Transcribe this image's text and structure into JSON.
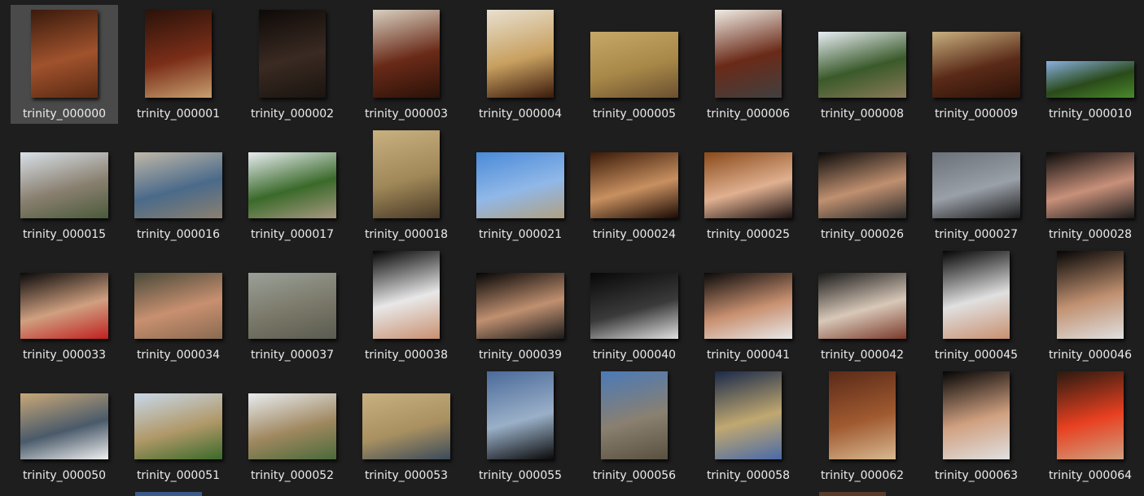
{
  "file_grid": {
    "selected_index": 0,
    "items": [
      {
        "name": "trinity_000000",
        "orientation": "portrait",
        "colors": [
          "#3a1a0c",
          "#a0522d",
          "#5a2a12"
        ]
      },
      {
        "name": "trinity_000001",
        "orientation": "portrait",
        "colors": [
          "#2a120a",
          "#7a2e18",
          "#c8a070"
        ]
      },
      {
        "name": "trinity_000002",
        "orientation": "portrait",
        "colors": [
          "#0e0a08",
          "#3a2a22",
          "#1a1410"
        ]
      },
      {
        "name": "trinity_000003",
        "orientation": "portrait",
        "colors": [
          "#d8d0c0",
          "#6a2a18",
          "#2a1208"
        ]
      },
      {
        "name": "trinity_000004",
        "orientation": "portrait",
        "colors": [
          "#e8e0d0",
          "#c8a060",
          "#3a1a0c"
        ]
      },
      {
        "name": "trinity_000005",
        "orientation": "landscape",
        "colors": [
          "#c8a868",
          "#a88848",
          "#6a5030"
        ]
      },
      {
        "name": "trinity_000006",
        "orientation": "portrait",
        "colors": [
          "#f0ece4",
          "#6a2a18",
          "#404040"
        ]
      },
      {
        "name": "trinity_000008",
        "orientation": "landscape",
        "colors": [
          "#e8eef4",
          "#3a5a2a",
          "#8a7a5a"
        ]
      },
      {
        "name": "trinity_000009",
        "orientation": "landscape",
        "colors": [
          "#c8b080",
          "#5a2a18",
          "#2a1208"
        ]
      },
      {
        "name": "trinity_000010",
        "orientation": "wide",
        "colors": [
          "#8ab0e0",
          "#2a4a1a",
          "#4a8a2a"
        ]
      },
      {
        "name": "trinity_000015",
        "orientation": "landscape",
        "colors": [
          "#d8e0e8",
          "#8a8070",
          "#4a5a3a"
        ]
      },
      {
        "name": "trinity_000016",
        "orientation": "landscape",
        "colors": [
          "#c0b8a8",
          "#4a6a8a",
          "#8a8070"
        ]
      },
      {
        "name": "trinity_000017",
        "orientation": "landscape",
        "colors": [
          "#e8ecf0",
          "#3a6a2a",
          "#a89880"
        ]
      },
      {
        "name": "trinity_000018",
        "orientation": "portrait",
        "colors": [
          "#c8b080",
          "#a08858",
          "#4a3a28"
        ]
      },
      {
        "name": "trinity_000021",
        "orientation": "landscape",
        "colors": [
          "#4a8ad8",
          "#90b8e8",
          "#b0a080"
        ]
      },
      {
        "name": "trinity_000024",
        "orientation": "landscape",
        "colors": [
          "#3a1a08",
          "#c89060",
          "#1a0a04"
        ]
      },
      {
        "name": "trinity_000025",
        "orientation": "landscape",
        "colors": [
          "#8a4a1a",
          "#e0b090",
          "#1a1010"
        ]
      },
      {
        "name": "trinity_000026",
        "orientation": "landscape",
        "colors": [
          "#0a0a0a",
          "#c09070",
          "#2a2a2a"
        ]
      },
      {
        "name": "trinity_000027",
        "orientation": "landscape",
        "colors": [
          "#6a7078",
          "#9aa0a8",
          "#1a1a1a"
        ]
      },
      {
        "name": "trinity_000028",
        "orientation": "landscape",
        "colors": [
          "#0a0a0a",
          "#c8907a",
          "#1a1a1a"
        ]
      },
      {
        "name": "trinity_000033",
        "orientation": "landscape",
        "colors": [
          "#0a0a0a",
          "#d0a080",
          "#c02020"
        ]
      },
      {
        "name": "trinity_000034",
        "orientation": "landscape",
        "colors": [
          "#4a4a3a",
          "#c89070",
          "#8a6a50"
        ]
      },
      {
        "name": "trinity_000037",
        "orientation": "landscape",
        "colors": [
          "#9aa098",
          "#7a7868",
          "#5a5a50"
        ]
      },
      {
        "name": "trinity_000038",
        "orientation": "portrait",
        "colors": [
          "#050505",
          "#e8e8e8",
          "#c89070"
        ]
      },
      {
        "name": "trinity_000039",
        "orientation": "landscape",
        "colors": [
          "#050505",
          "#c09070",
          "#1a1a1a"
        ]
      },
      {
        "name": "trinity_000040",
        "orientation": "landscape",
        "colors": [
          "#080808",
          "#3a3a3a",
          "#e0e0e0"
        ]
      },
      {
        "name": "trinity_000041",
        "orientation": "landscape",
        "colors": [
          "#0a0a0a",
          "#c89070",
          "#e8e8e8"
        ]
      },
      {
        "name": "trinity_000042",
        "orientation": "landscape",
        "colors": [
          "#1a1a1a",
          "#d8c8b8",
          "#7a3a2a"
        ]
      },
      {
        "name": "trinity_000045",
        "orientation": "portrait",
        "colors": [
          "#050505",
          "#e0e0e0",
          "#c89070"
        ]
      },
      {
        "name": "trinity_000046",
        "orientation": "portrait",
        "colors": [
          "#050505",
          "#c09070",
          "#e0e0e0"
        ]
      },
      {
        "name": "trinity_000050",
        "orientation": "landscape",
        "colors": [
          "#c8a878",
          "#4a5a6a",
          "#f0f0f0"
        ]
      },
      {
        "name": "trinity_000051",
        "orientation": "landscape",
        "colors": [
          "#c8d8e8",
          "#b09868",
          "#3a6a2a"
        ]
      },
      {
        "name": "trinity_000052",
        "orientation": "landscape",
        "colors": [
          "#e8ecf0",
          "#a08860",
          "#4a6a3a"
        ]
      },
      {
        "name": "trinity_000053",
        "orientation": "landscape",
        "colors": [
          "#c8b080",
          "#a89060",
          "#3a4a5a"
        ]
      },
      {
        "name": "trinity_000055",
        "orientation": "portrait",
        "colors": [
          "#4a6a9a",
          "#9ab0c8",
          "#0a0a0a"
        ]
      },
      {
        "name": "trinity_000056",
        "orientation": "portrait",
        "colors": [
          "#4a7ab8",
          "#8a8070",
          "#5a5040"
        ]
      },
      {
        "name": "trinity_000058",
        "orientation": "portrait",
        "colors": [
          "#1a2a4a",
          "#c0a870",
          "#4a6aa8"
        ]
      },
      {
        "name": "trinity_000062",
        "orientation": "portrait",
        "colors": [
          "#5a2a18",
          "#a05a30",
          "#d8b890"
        ]
      },
      {
        "name": "trinity_000063",
        "orientation": "portrait",
        "colors": [
          "#050505",
          "#d0a080",
          "#e0e0e0"
        ]
      },
      {
        "name": "trinity_000064",
        "orientation": "portrait",
        "colors": [
          "#2a1a10",
          "#e84020",
          "#d0a080"
        ]
      }
    ],
    "next_row_peek": [
      {
        "column": 1,
        "color": "#3a5a8a"
      },
      {
        "column": 7,
        "color": "#5a3a28"
      }
    ]
  }
}
